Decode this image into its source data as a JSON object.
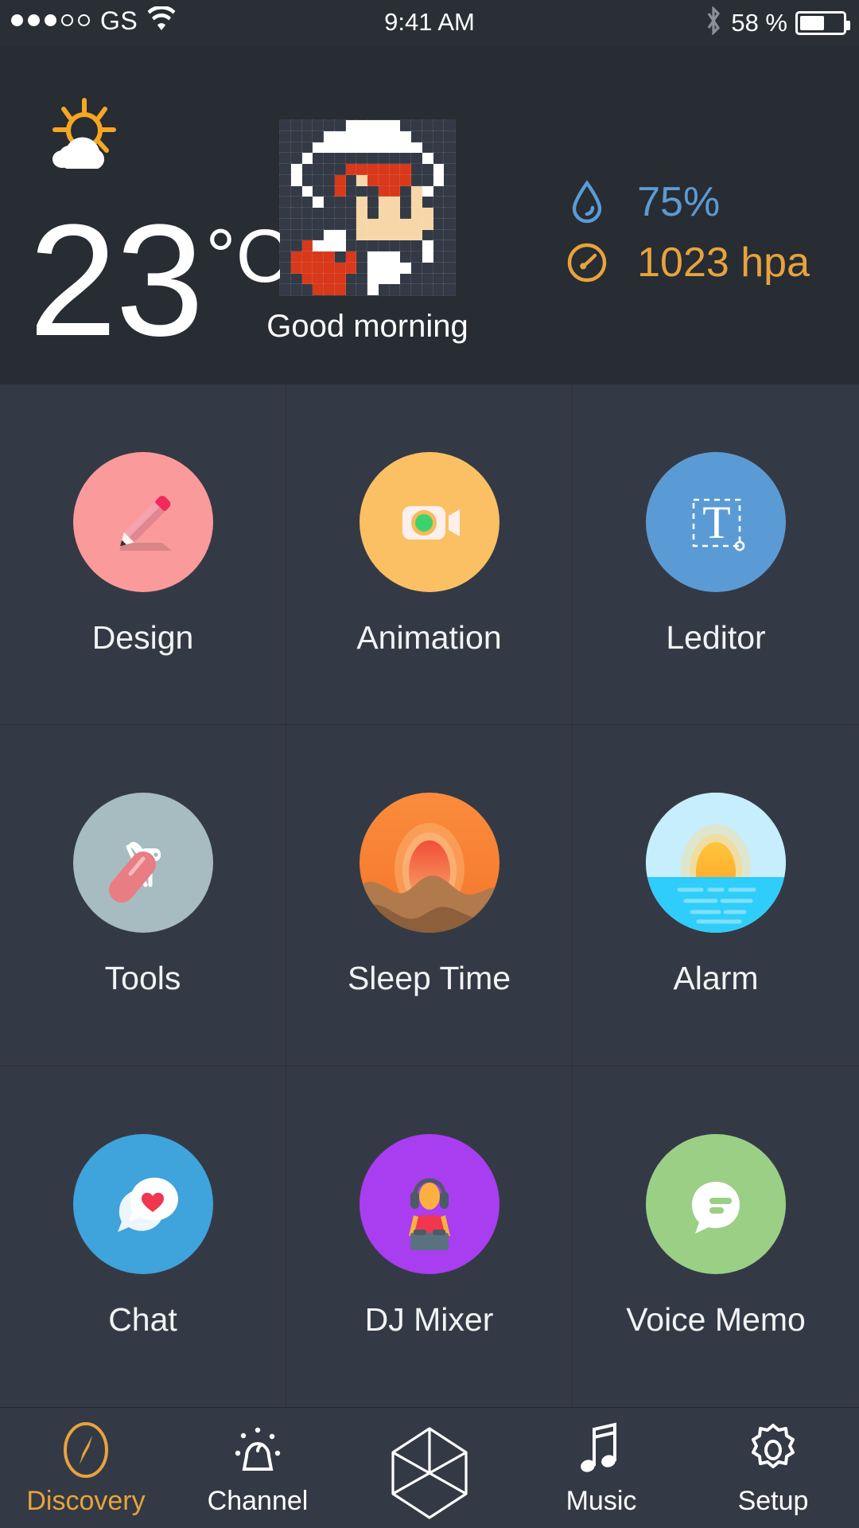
{
  "status_bar": {
    "signal_dots_total": 5,
    "signal_dots_filled": 3,
    "carrier": "GS",
    "wifi_icon": "wifi-icon",
    "time": "9:41 AM",
    "bluetooth_icon": "bluetooth-icon",
    "battery_percent": "58 %",
    "battery_level": 58
  },
  "weather": {
    "condition_icon": "sun-behind-cloud-icon",
    "temperature": "23",
    "unit": "°C",
    "greeting": "Good morning",
    "avatar_icon": "pixel-art-avatar",
    "metrics": [
      {
        "id": "humidity",
        "icon": "water-drop-icon",
        "value": "75%",
        "color": "#5b9bd5"
      },
      {
        "id": "pressure",
        "icon": "gauge-icon",
        "value": "1023 hpa",
        "color": "#e8a33d"
      }
    ]
  },
  "apps": [
    {
      "label": "Design",
      "icon": "pencil-icon",
      "bg": "#fa9a9a"
    },
    {
      "label": "Animation",
      "icon": "video-camera-icon",
      "bg": "#fbc064"
    },
    {
      "label": "Leditor",
      "icon": "text-tool-icon",
      "bg": "#5b9bd5"
    },
    {
      "label": "Tools",
      "icon": "swiss-knife-icon",
      "bg": "#a7bcc0"
    },
    {
      "label": "Sleep Time",
      "icon": "sunset-dunes-icon",
      "bg": "#f57f2e"
    },
    {
      "label": "Alarm",
      "icon": "sunrise-sea-icon",
      "bg": "#2ecdfa"
    },
    {
      "label": "Chat",
      "icon": "chat-heart-icon",
      "bg": "#3fa3dc"
    },
    {
      "label": "DJ Mixer",
      "icon": "dj-icon",
      "bg": "#a93ef0"
    },
    {
      "label": "Voice Memo",
      "icon": "speech-bubble-icon",
      "bg": "#9ccf86"
    }
  ],
  "nav": {
    "active_color": "#e8a33d",
    "items": [
      {
        "label": "Discovery",
        "icon": "compass-icon",
        "active": true
      },
      {
        "label": "Channel",
        "icon": "lamp-icon",
        "active": false
      },
      {
        "label": "",
        "icon": "cube-icon",
        "active": false
      },
      {
        "label": "Music",
        "icon": "music-note-icon",
        "active": false
      },
      {
        "label": "Setup",
        "icon": "gear-icon",
        "active": false
      }
    ]
  }
}
